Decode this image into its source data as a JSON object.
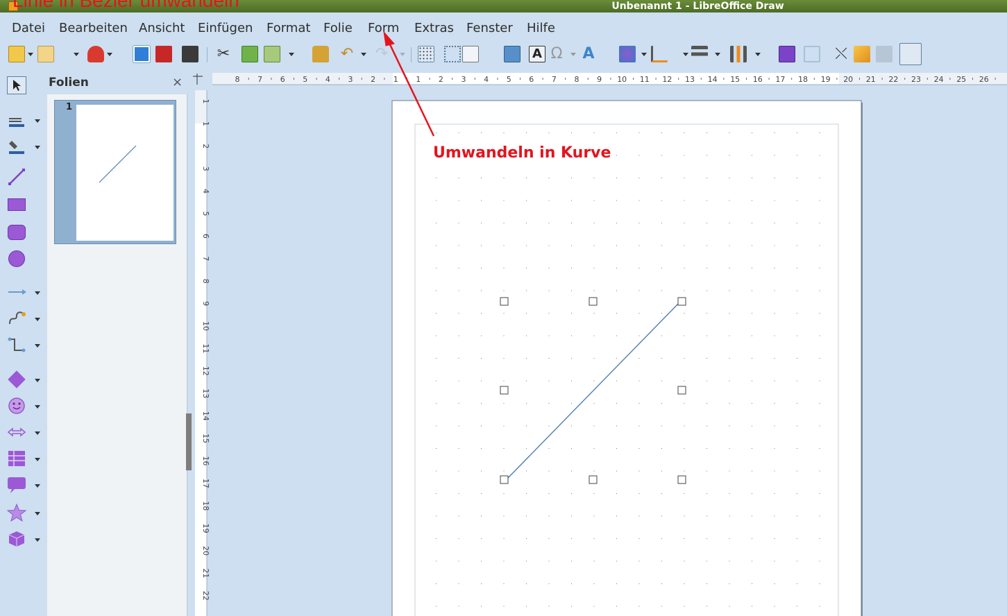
{
  "window": {
    "title": "Unbenannt 1 - LibreOffice Draw",
    "overlay_title": "Linie in Bezier umwandeln"
  },
  "menu": {
    "items": [
      "Datei",
      "Bearbeiten",
      "Ansicht",
      "Einfügen",
      "Format",
      "Folie",
      "Form",
      "Extras",
      "Fenster",
      "Hilfe"
    ]
  },
  "toolbar": {
    "icons": [
      "new-icon",
      "open-icon",
      "templates-icon",
      "export-icon",
      "pdf-icon",
      "print-icon",
      "cut-icon",
      "copy-icon",
      "paste-icon",
      "clone-formatting-icon",
      "undo-icon",
      "redo-icon",
      "grid-icon",
      "helplines-icon",
      "zoom-pan-icon",
      "image-icon",
      "textbox-icon",
      "special-char-icon",
      "fontwork-icon",
      "transform-icon",
      "align-icon",
      "arrange-icon",
      "distribute-icon",
      "shadow-icon",
      "crop-icon",
      "points-icon",
      "glue-icon",
      "extrusion-icon",
      "line-color-icon"
    ]
  },
  "left_toolbar": {
    "icons": [
      "select-icon",
      "line-style-icon",
      "fill-color-icon",
      "line-icon",
      "rectangle-icon",
      "rounded-rect-icon",
      "ellipse-icon",
      "arrow-line-icon",
      "curve-icon",
      "connector-icon",
      "diamond-icon",
      "smiley-icon",
      "double-arrow-icon",
      "table-icon",
      "callout-icon",
      "star-icon",
      "cube-icon"
    ]
  },
  "slide_panel": {
    "title": "Folien",
    "close": "×",
    "slides": [
      {
        "number": "1"
      }
    ]
  },
  "rulers": {
    "h_ticks": [
      "8",
      "7",
      "6",
      "5",
      "4",
      "3",
      "2",
      "1",
      "1",
      "2",
      "3",
      "4",
      "5",
      "6",
      "7",
      "8",
      "9",
      "10",
      "11",
      "12",
      "13",
      "14",
      "15",
      "16",
      "17",
      "18",
      "19",
      "20",
      "21",
      "22",
      "23",
      "24",
      "25",
      "26"
    ],
    "v_ticks": [
      "1",
      "1",
      "2",
      "3",
      "4",
      "5",
      "6",
      "7",
      "8",
      "9",
      "10",
      "11",
      "12",
      "13",
      "14",
      "15",
      "16",
      "17",
      "18",
      "19",
      "20",
      "21",
      "22"
    ]
  },
  "annotation": {
    "text": "Umwandeln in Kurve",
    "color": "#e4141e"
  },
  "colors": {
    "accent": "#4f7fb0",
    "background": "#cddff0",
    "annotation": "#e4141e"
  }
}
